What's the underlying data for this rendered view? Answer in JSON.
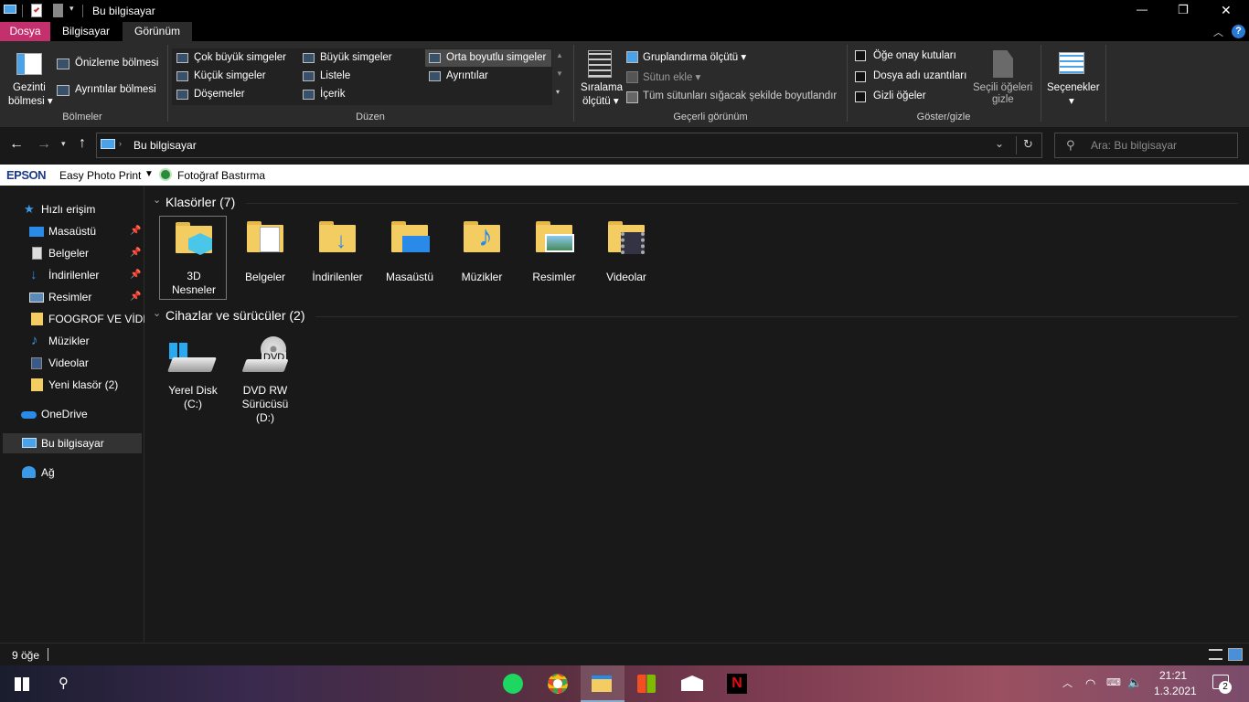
{
  "window": {
    "title": "Bu bilgisayar",
    "min": "—",
    "max": "❐",
    "close": "✕"
  },
  "tabs": {
    "file": "Dosya",
    "computer": "Bilgisayar",
    "view": "Görünüm",
    "help": "?"
  },
  "ribbon": {
    "panes": {
      "nav_pane": "Gezinti\nbölmesi",
      "nav_pane_1": "Gezinti",
      "nav_pane_2": "bölmesi ▾",
      "preview": "Önizleme bölmesi",
      "details": "Ayrıntılar bölmesi",
      "group": "Bölmeler"
    },
    "layout": {
      "items": [
        "Çok büyük simgeler",
        "Büyük simgeler",
        "Orta boyutlu simgeler",
        "Küçük simgeler",
        "Listele",
        "Ayrıntılar",
        "Döşemeler",
        "İçerik"
      ],
      "group": "Düzen"
    },
    "current_view": {
      "sort": "Sıralama",
      "sort2": "ölçütü ▾",
      "group_by": "Gruplandırma ölçütü ▾",
      "add_column": "Sütun ekle ▾",
      "fit_columns": "Tüm sütunları sığacak şekilde boyutlandır",
      "group": "Geçerli görünüm"
    },
    "show_hide": {
      "checkboxes": "Öğe onay kutuları",
      "extensions": "Dosya adı uzantıları",
      "hidden": "Gizli öğeler",
      "hide_selected_1": "Seçili öğeleri",
      "hide_selected_2": "gizle",
      "group": "Göster/gizle"
    },
    "options": {
      "label": "Seçenekler",
      "arrow": "▾"
    }
  },
  "address": {
    "path": "Bu bilgisayar",
    "search_placeholder": "Ara: Bu bilgisayar"
  },
  "epson": {
    "brand": "EPSON",
    "app": "Easy Photo Print",
    "print": "Fotoğraf Bastırma"
  },
  "nav": {
    "quick_access": "Hızlı erişim",
    "items": [
      {
        "label": "Masaüstü",
        "pinned": true
      },
      {
        "label": "Belgeler",
        "pinned": true
      },
      {
        "label": "İndirilenler",
        "pinned": true
      },
      {
        "label": "Resimler",
        "pinned": true
      },
      {
        "label": "FOOGROF VE VİDEO",
        "pinned": false
      },
      {
        "label": "Müzikler",
        "pinned": false
      },
      {
        "label": "Videolar",
        "pinned": false
      },
      {
        "label": "Yeni klasör (2)",
        "pinned": false
      }
    ],
    "onedrive": "OneDrive",
    "this_pc": "Bu bilgisayar",
    "network": "Ağ"
  },
  "content": {
    "folders_header": "Klasörler (7)",
    "folders": [
      {
        "name": "3D\nNesneler",
        "name1": "3D",
        "name2": "Nesneler"
      },
      {
        "name1": "Belgeler"
      },
      {
        "name1": "İndirilenler"
      },
      {
        "name1": "Masaüstü"
      },
      {
        "name1": "Müzikler"
      },
      {
        "name1": "Resimler"
      },
      {
        "name1": "Videolar"
      }
    ],
    "devices_header": "Cihazlar ve sürücüler (2)",
    "devices": [
      {
        "name1": "Yerel Disk",
        "name2": "(C:)"
      },
      {
        "name1": "DVD RW",
        "name2": "Sürücüsü",
        "name3": "(D:)",
        "badge": "DVD"
      }
    ]
  },
  "status": {
    "count": "9 öğe"
  },
  "taskbar": {
    "time": "21:21",
    "date": "1.3.2021",
    "notifications": "2"
  },
  "colors": {
    "accent": "#1e6fb8",
    "file_tab": "#c4306e",
    "folder": "#f4cd62"
  }
}
